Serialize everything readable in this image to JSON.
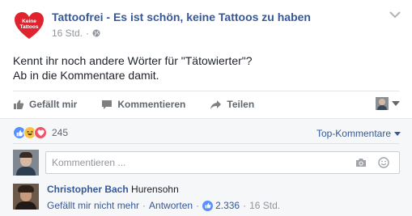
{
  "post": {
    "page_name": "Tattoofrei - Es ist schön, keine Tattoos zu haben",
    "logo_text_1": "Keine",
    "logo_text_2": "Tattoos",
    "timestamp": "16 Std.",
    "text_line_1": "Kennt ihr noch andere Wörter für \"Tätowierter\"?",
    "text_line_2": "Ab in die Kommentare damit."
  },
  "actions": {
    "like_label": "Gefällt mir",
    "comment_label": "Kommentieren",
    "share_label": "Teilen"
  },
  "reactions": {
    "count": "245",
    "sort_label": "Top-Kommentare"
  },
  "composer": {
    "placeholder": "Kommentieren ..."
  },
  "comment": {
    "author": "Christopher Bach",
    "text": "Hurensohn",
    "unlike_label": "Gefällt mir nicht mehr",
    "reply_label": "Antworten",
    "like_count": "2.336",
    "time": "16 Std."
  },
  "colors": {
    "link_blue": "#365899",
    "like_blue": "#5890ff",
    "love_red": "#f25268",
    "haha_yellow": "#f7c34a",
    "logo_red": "#e0242f"
  },
  "icons": [
    "heart-logo-icon",
    "globe-icon",
    "chevron-down-icon",
    "thumbs-up-icon",
    "comment-bubble-icon",
    "share-arrow-icon",
    "camera-icon",
    "smiley-icon"
  ]
}
